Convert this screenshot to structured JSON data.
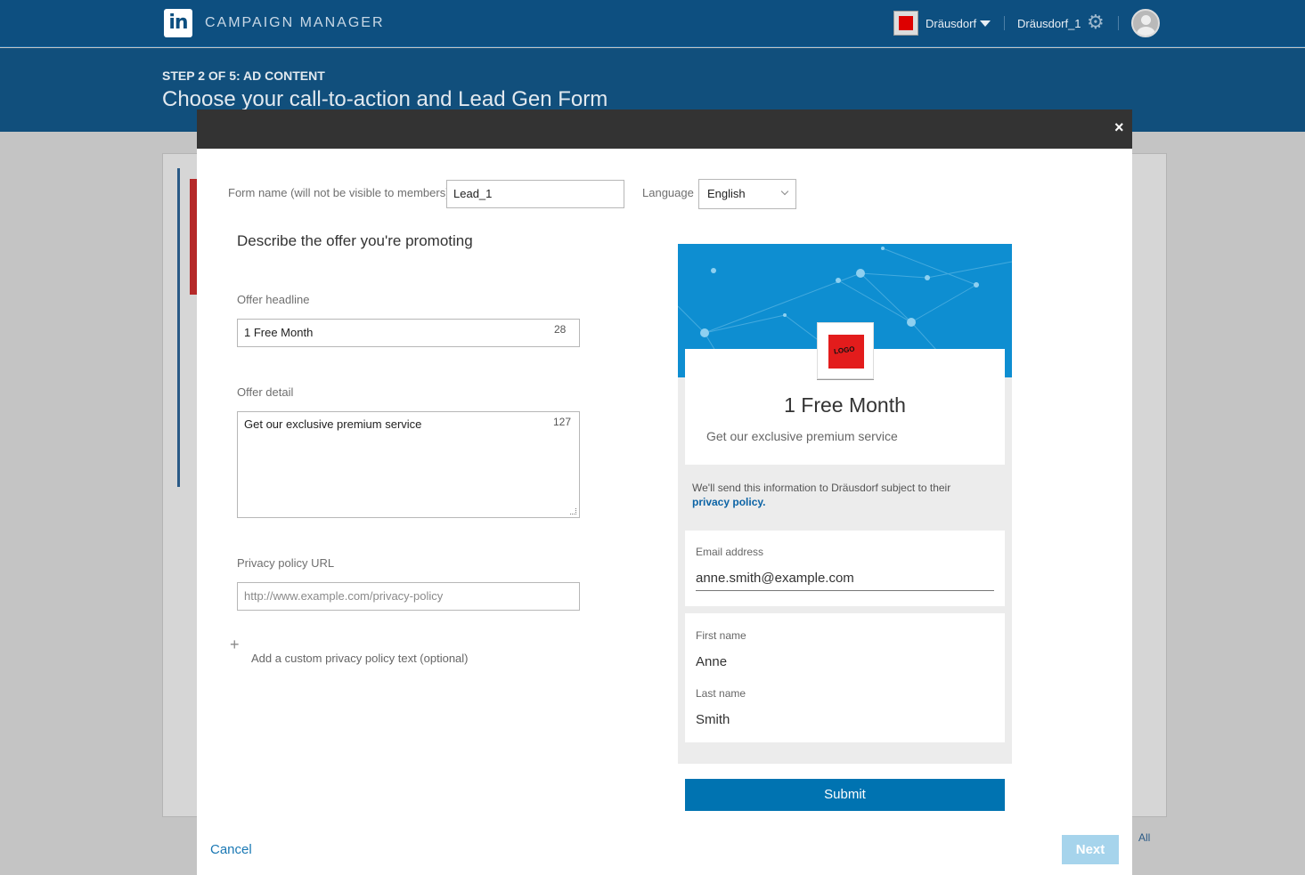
{
  "topbar": {
    "logo": "in",
    "app_title": "CAMPAIGN MANAGER",
    "account_name": "Dräusdorf",
    "account_id": "Dräusdorf_1",
    "settings_icon": "gear-icon"
  },
  "header": {
    "step": "STEP 2 OF 5: AD CONTENT",
    "title": "Choose your call-to-action and Lead Gen Form"
  },
  "background": {
    "all_link": "All"
  },
  "modal": {
    "close_label": "×",
    "form_name_label": "Form name (will not be visible to members)",
    "form_name_value": "Lead_1",
    "language_label": "Language",
    "language_value": "English",
    "section_title": "Describe the offer you're promoting",
    "offer_headline_label": "Offer headline",
    "offer_headline_value": "1 Free Month",
    "offer_headline_counter": "28",
    "offer_detail_label": "Offer detail",
    "offer_detail_value": "Get our exclusive premium service",
    "offer_detail_counter": "127",
    "privacy_url_label": "Privacy policy URL",
    "privacy_url_placeholder": "http://www.example.com/privacy-policy",
    "add_icon": "+",
    "add_custom_text": "Add a custom privacy policy text (optional)",
    "cancel_label": "Cancel",
    "next_label": "Next"
  },
  "preview": {
    "logo_text": "LOGO",
    "headline": "1 Free Month",
    "detail": "Get our exclusive premium service",
    "notice_prefix": "We'll send this information to Dräusdorf subject to their",
    "notice_link": "privacy policy.",
    "email_label": "Email address",
    "email_value": "anne.smith@example.com",
    "first_name_label": "First name",
    "first_name_value": "Anne",
    "last_name_label": "Last name",
    "last_name_value": "Smith",
    "submit_label": "Submit"
  },
  "colors": {
    "brand": "#0073b1",
    "topbar": "#0d4f80",
    "next_disabled": "#a6d4ec"
  }
}
